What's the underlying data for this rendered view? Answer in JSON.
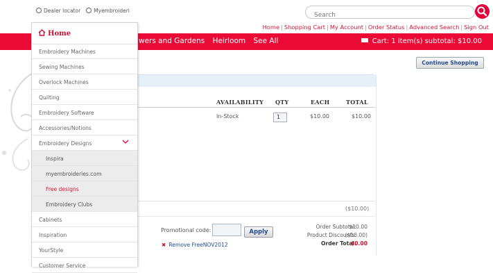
{
  "header": {
    "dealer_locator": "Dealer locator",
    "myembroideries": "Myembroideri",
    "search_placeholder": "Search",
    "top_links": [
      "Home",
      "Shopping Cart",
      "My Account",
      "Order Status",
      "Advanced Search",
      "Sign Out"
    ]
  },
  "navbar": {
    "categories": [
      "wers and Gardens",
      "Heirloom",
      "See All"
    ],
    "cart_text": "Cart: 1 item(s) subtotal: $10.00"
  },
  "continue_shopping": "Continue Shopping",
  "cart": {
    "columns": [
      "AVAILABILITY",
      "QTY",
      "EACH",
      "TOTAL"
    ],
    "row": {
      "availability": "In-Stock",
      "qty": "1",
      "each": "$10.00",
      "total": "$10.00"
    },
    "discount_line": "($10.00)",
    "promo_label": "Promotional code:",
    "apply_label": "Apply",
    "remove_label": "Remove FreeNOV2012",
    "summary": [
      {
        "label": "Order Subtotal:",
        "value": "$10.00"
      },
      {
        "label": "Product Discounts:",
        "value": "($10.00)"
      },
      {
        "label": "Order Total:",
        "value": "$0.00"
      }
    ]
  },
  "menu": {
    "home": "Home",
    "items": [
      "Embroidery Machines",
      "Sewing Machines",
      "Overlock Machines",
      "Quilting",
      "Embroidery Software",
      "Accessories/Notions",
      "Embroidery Designs"
    ],
    "subitems": [
      "Inspira",
      "myembroideries.com",
      "Free designs",
      "Embroidery Clubs"
    ],
    "items_after": [
      "Cabinets",
      "Inspiration",
      "YourStyle",
      "Customer Service"
    ]
  },
  "colors": {
    "brand_red": "#ea0a35",
    "link_red": "#cf1437",
    "link_blue": "#244b8f"
  }
}
